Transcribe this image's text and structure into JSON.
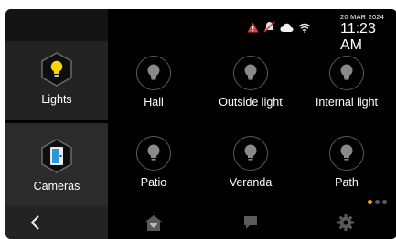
{
  "sidebar": {
    "items": [
      {
        "label": "Lights",
        "icon": "lightbulb-icon",
        "active": false
      },
      {
        "label": "Cameras",
        "icon": "door-camera-icon",
        "active": true
      }
    ]
  },
  "status": {
    "date": "20 MAR 2024",
    "time": "11:23 AM",
    "icons": [
      "alert-triangle-icon",
      "bell-off-icon",
      "cloud-icon",
      "wifi-icon"
    ]
  },
  "tiles": [
    {
      "label": "Hall"
    },
    {
      "label": "Outside light"
    },
    {
      "label": "Internal light"
    },
    {
      "label": "Patio"
    },
    {
      "label": "Veranda"
    },
    {
      "label": "Path"
    }
  ],
  "pager": {
    "total": 3,
    "current": 1
  },
  "colors": {
    "accent": "#f39c1f",
    "alert": "#e53935",
    "bulb_on": "#ffd400",
    "bulb_off": "#8a8a8a"
  },
  "bottom_nav": [
    "back-chevron-icon",
    "home-heart-icon",
    "chat-icon",
    "gear-icon"
  ]
}
